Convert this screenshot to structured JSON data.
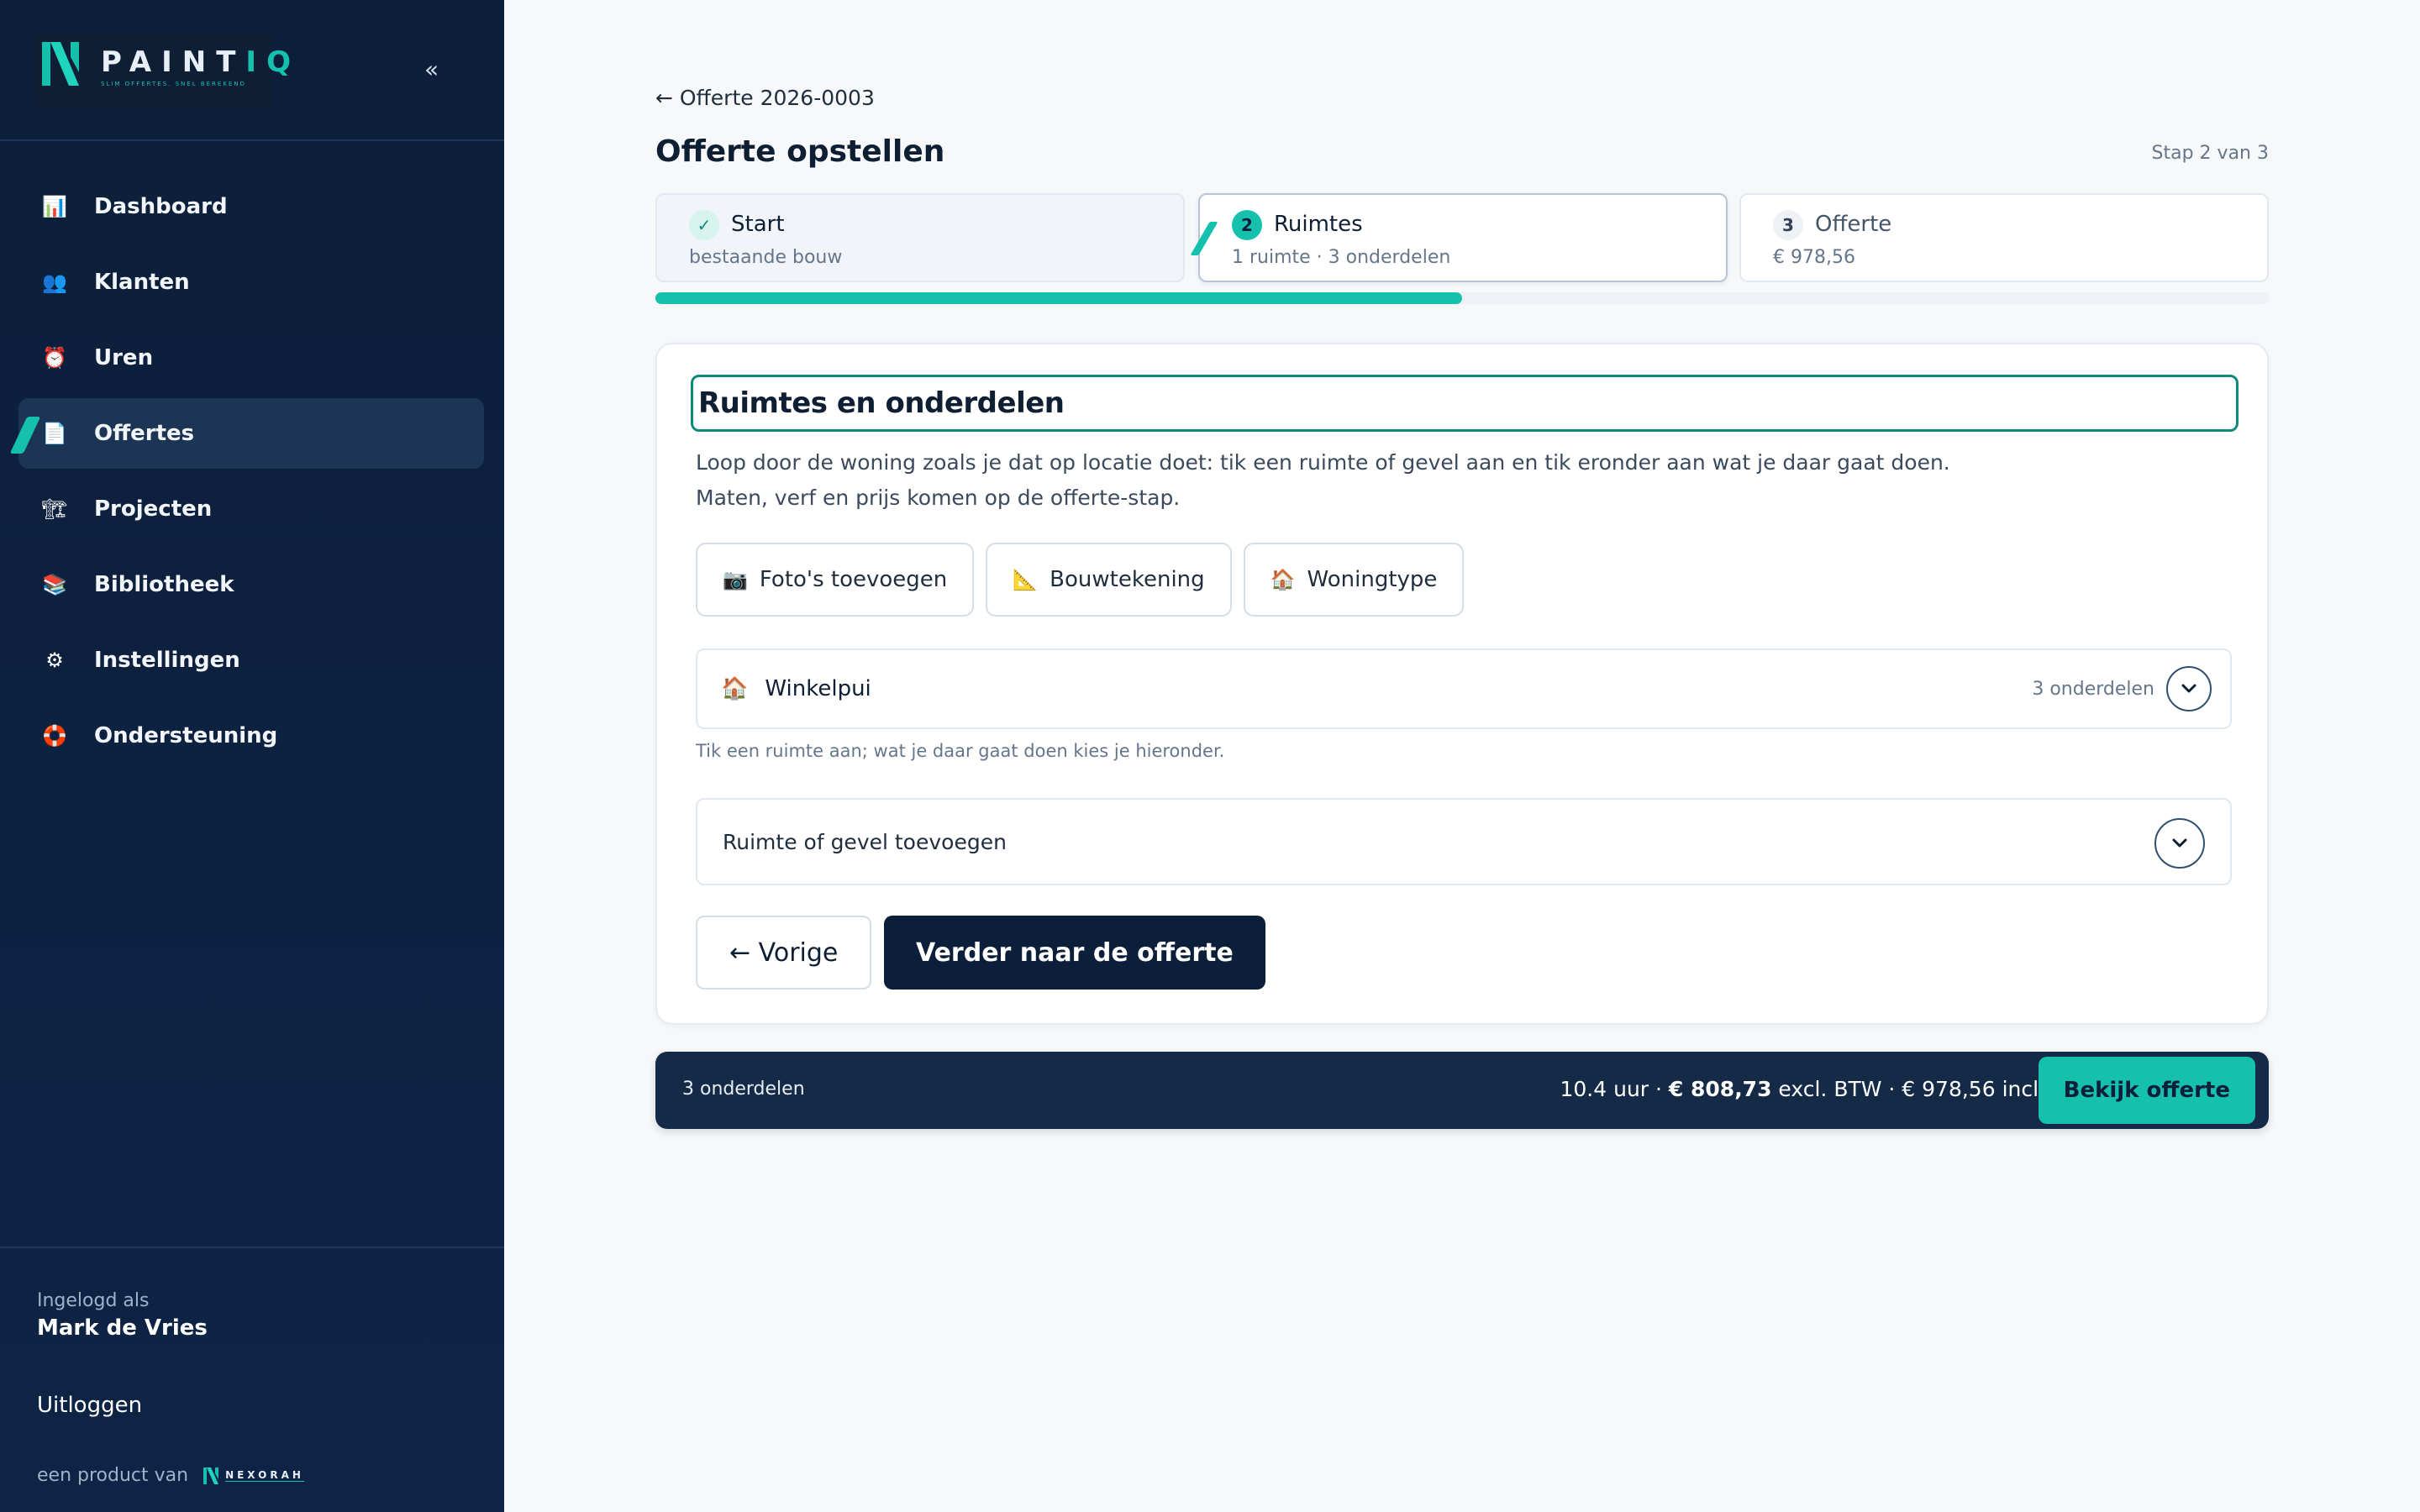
{
  "app": {
    "logo_main": "PAINT",
    "logo_accent": "IQ",
    "logo_tagline": "SLIM OFFERTES. SNEL BEREKEND",
    "collapse_icon": "«"
  },
  "sidebar": {
    "items": [
      {
        "label": "Dashboard",
        "icon": "📊"
      },
      {
        "label": "Klanten",
        "icon": "👥"
      },
      {
        "label": "Uren",
        "icon": "⏰"
      },
      {
        "label": "Offertes",
        "icon": "📄"
      },
      {
        "label": "Projecten",
        "icon": "🏗"
      },
      {
        "label": "Bibliotheek",
        "icon": "📚"
      },
      {
        "label": "Instellingen",
        "icon": "⚙"
      },
      {
        "label": "Ondersteuning",
        "icon": "🛟"
      }
    ],
    "active_index": 3,
    "logged_in_label": "Ingelogd als",
    "user_name": "Mark de Vries",
    "logout_label": "Uitloggen",
    "product_of_label": "een product van",
    "brand_label": "NEXORAH"
  },
  "header": {
    "back_link": "← Offerte 2026-0003",
    "title": "Offerte opstellen",
    "step_count": "Stap 2 van 3"
  },
  "steps": [
    {
      "badge": "✓",
      "title": "Start",
      "subtitle": "bestaande bouw"
    },
    {
      "badge": "2",
      "title": "Ruimtes",
      "subtitle": "1 ruimte · 3 onderdelen"
    },
    {
      "badge": "3",
      "title": "Offerte",
      "subtitle": "€ 978,56"
    }
  ],
  "progress_fraction": 0.5,
  "card": {
    "title": "Ruimtes en onderdelen",
    "desc_line1": "Loop door de woning zoals je dat op locatie doet: tik een ruimte of gevel aan en tik eronder aan wat je daar gaat doen.",
    "desc_line2": "Maten, verf en prijs komen op de offerte-stap.",
    "tools": [
      {
        "icon": "📷",
        "label": "Foto's toevoegen"
      },
      {
        "icon": "📐",
        "label": "Bouwtekening"
      },
      {
        "icon": "🏠",
        "label": "Woningtype"
      }
    ],
    "room": {
      "icon": "🏠",
      "name": "Winkelpui",
      "count": "3 onderdelen"
    },
    "hint": "Tik een ruimte aan; wat je daar gaat doen kies je hieronder.",
    "add_label": "Ruimte of gevel toevoegen",
    "prev_label": "← Vorige",
    "next_label": "Verder naar de offerte"
  },
  "summary": {
    "left": "3 onderdelen",
    "hours": "10.4 uur · ",
    "excl_amount": "€ 808,73",
    "excl_suffix": " excl. BTW · € 978,56 incl.",
    "button": "Bekijk offerte"
  }
}
